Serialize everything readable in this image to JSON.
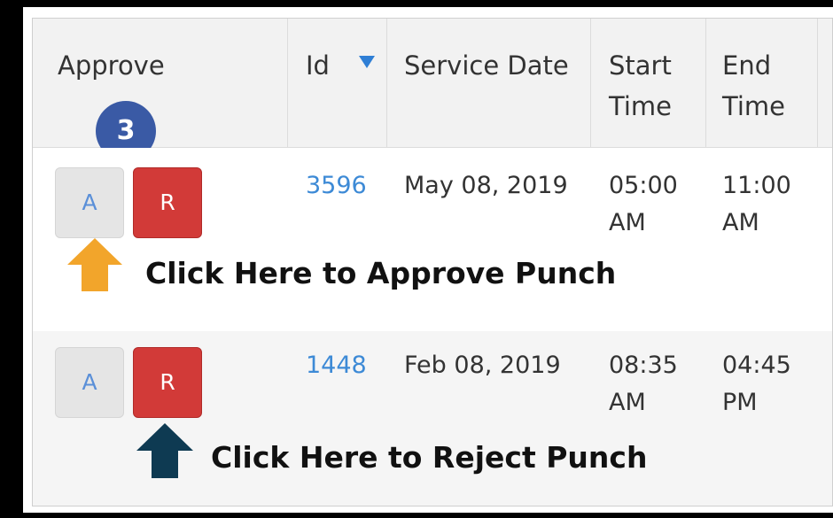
{
  "columns": {
    "approve": "Approve",
    "id": "Id",
    "service_date": "Service Date",
    "start_time": "Start\nTime",
    "end_time": "End\nTime"
  },
  "step_badge": "3",
  "rows": [
    {
      "approve_label": "A",
      "reject_label": "R",
      "id": "3596",
      "service_date": "May 08, 2019",
      "start_time": "05:00\nAM",
      "end_time": "11:00\nAM"
    },
    {
      "approve_label": "A",
      "reject_label": "R",
      "id": "1448",
      "service_date": "Feb 08, 2019",
      "start_time": "08:35\nAM",
      "end_time": "04:45\nPM"
    }
  ],
  "callouts": {
    "approve": "Click Here to Approve Punch",
    "reject": "Click Here to Reject Punch"
  },
  "colors": {
    "approve_arrow": "#f2a52b",
    "reject_arrow": "#0e3a52",
    "badge": "#3a5aa5",
    "reject_button": "#d23a38",
    "link": "#3d8ad6"
  }
}
